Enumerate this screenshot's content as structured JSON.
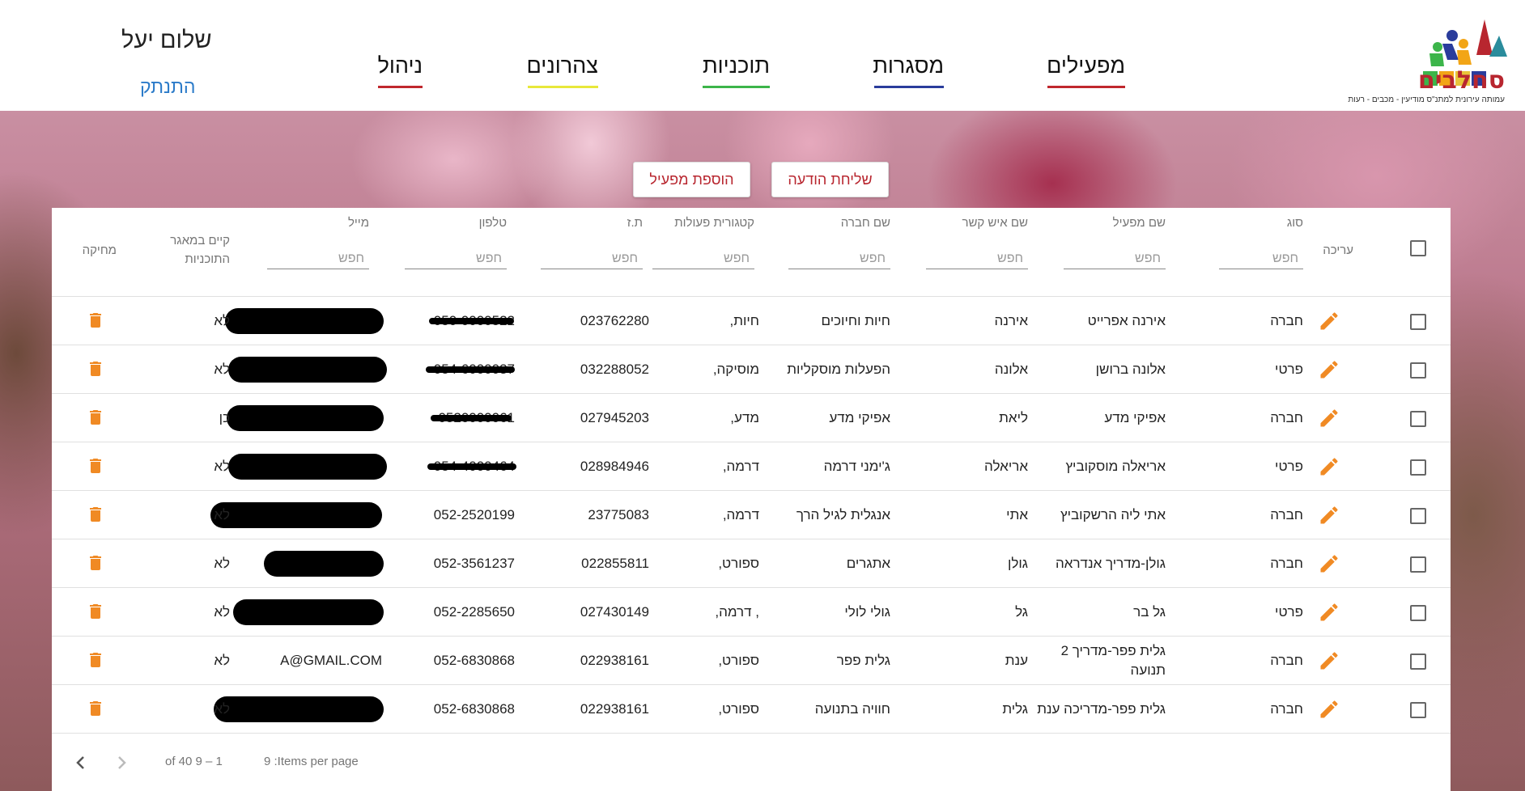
{
  "brand": {
    "logo_text": "סחלבים",
    "logo_subtitle": "עמותה עירונית למתנ\"ס מודיעין - מכבים - רעות"
  },
  "nav": [
    {
      "label": "מפעילים",
      "color": "#c0272d"
    },
    {
      "label": "מסגרות",
      "color": "#2a3c9c"
    },
    {
      "label": "תוכניות",
      "color": "#3cb54a"
    },
    {
      "label": "צהרונים",
      "color": "#e8e83a"
    },
    {
      "label": "ניהול",
      "color": "#c0272d"
    }
  ],
  "user": {
    "greeting": "שלום יעל",
    "logout": "התנתק"
  },
  "actions": {
    "send_message": "שליחת הודעה",
    "add_operator": "הוספת מפעיל"
  },
  "table": {
    "columns": {
      "edit": "עריכה",
      "type": "סוג",
      "operator_name": "שם מפעיל",
      "contact_name": "שם איש קשר",
      "company_name": "שם חברה",
      "activity_category": "קטגורית פעולות",
      "id_number": "ת.ז",
      "phone": "טלפון",
      "email": "מייל",
      "in_pool_line1": "קיים במאגר",
      "in_pool_line2": "התוכניות",
      "delete": "מחיקה"
    },
    "filter_placeholder": "חפש",
    "rows": [
      {
        "type": "חברה",
        "operator_name": "אירנה אפרייט",
        "operator_name_2": "",
        "contact_name": "אירנה",
        "company_name": "חיות וחיוכים",
        "category": "חיות,",
        "id_number": "023762280",
        "phone": "050-0000522",
        "email": "",
        "in_pool": "לא"
      },
      {
        "type": "פרטי",
        "operator_name": "אלונה ברושן",
        "operator_name_2": "",
        "contact_name": "אלונה",
        "company_name": "הפעלות מוסקליות",
        "category": "מוסיקה,",
        "id_number": "032288052",
        "phone": "054-6000037",
        "email": "",
        "in_pool": "לא"
      },
      {
        "type": "חברה",
        "operator_name": "אפיקי מדע",
        "operator_name_2": "",
        "contact_name": "ליאת",
        "company_name": "אפיקי מדע",
        "category": "מדע,",
        "id_number": "027945203",
        "phone": "0520000061",
        "email": "",
        "in_pool": "כן"
      },
      {
        "type": "פרטי",
        "operator_name": "אריאלה מוסקוביץ",
        "operator_name_2": "",
        "contact_name": "אריאלה",
        "company_name": "ג'ימני דרמה",
        "category": "דרמה,",
        "id_number": "028984946",
        "phone": "054-4000464",
        "email": "",
        "in_pool": "לא"
      },
      {
        "type": "חברה",
        "operator_name": "אתי ליה הרשקוביץ",
        "operator_name_2": "",
        "contact_name": "אתי",
        "company_name": "אנגלית לגיל הרך",
        "category": "דרמה,",
        "id_number": "23775083",
        "phone": "052-2520199",
        "email": "",
        "in_pool": "לא"
      },
      {
        "type": "חברה",
        "operator_name": "גולן-מדריך אנדראה",
        "operator_name_2": "",
        "contact_name": "גולן",
        "company_name": "אתגרים",
        "category": "ספורט,",
        "id_number": "022855811",
        "phone": "052-3561237",
        "email": "",
        "in_pool": "לא"
      },
      {
        "type": "פרטי",
        "operator_name": "גל בר",
        "operator_name_2": "",
        "contact_name": "גל",
        "company_name": "גולי לולי",
        "category": ", דרמה,",
        "id_number": "027430149",
        "phone": "052-2285650",
        "email": "",
        "in_pool": "לא"
      },
      {
        "type": "חברה",
        "operator_name": "גלית פפר-מדריך 2",
        "operator_name_2": "תנועה",
        "contact_name": "ענת",
        "company_name": "גלית פפר",
        "category": "ספורט,",
        "id_number": "022938161",
        "phone": "052-6830868",
        "email": "A@GMAIL.COM",
        "in_pool": "לא"
      },
      {
        "type": "חברה",
        "operator_name": "גלית פפר-מדריכה ענת",
        "operator_name_2": "",
        "contact_name": "גלית",
        "company_name": "חוויה בתנועה",
        "category": "ספורט,",
        "id_number": "022938161",
        "phone": "052-6830868",
        "email": "",
        "in_pool": "לא"
      }
    ]
  },
  "paginator": {
    "items_per_page": "9 :Items per page",
    "range": "of 40 9 – 1"
  },
  "colors": {
    "accent": "#b8262f",
    "icon_orange": "#f08a24",
    "link": "#2b7bc9"
  }
}
